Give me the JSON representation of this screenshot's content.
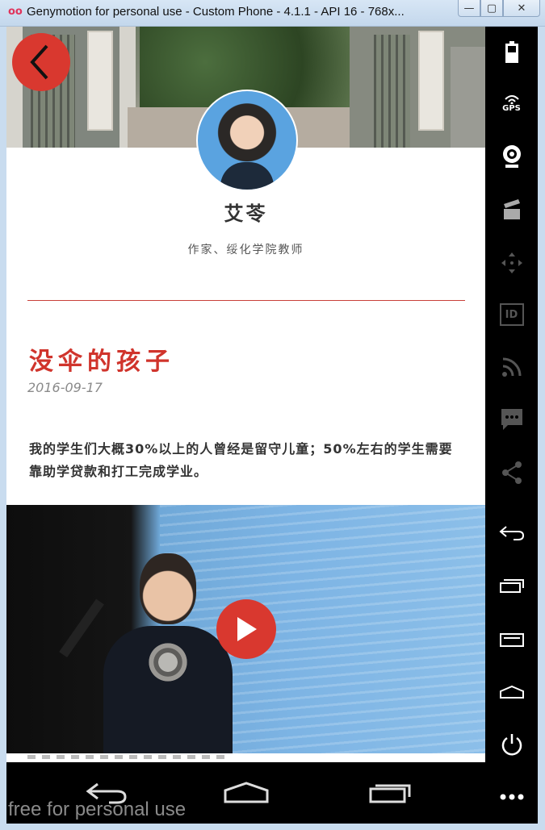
{
  "window": {
    "title": "Genymotion for personal use - Custom Phone - 4.1.1 - API 16 - 768x...",
    "app_icon_glyph": "oo",
    "minimize_glyph": "—",
    "maximize_glyph": "▢",
    "close_glyph": "✕"
  },
  "profile": {
    "name": "艾苓",
    "subtitle": "作家、绥化学院教师"
  },
  "article": {
    "title": "没伞的孩子",
    "date": "2016-09-17",
    "body": "我的学生们大概30%以上的人曾经是留守儿童；50%左右的学生需要靠助学贷款和打工完成学业。"
  },
  "side_panel": {
    "gps_label": "GPS",
    "id_label": "ID",
    "icons": [
      "battery-icon",
      "gps-icon",
      "webcam-icon",
      "clapper-icon",
      "dpad-icon",
      "id-icon",
      "rss-icon",
      "sms-icon",
      "share-icon",
      "back-icon",
      "recent-apps-icon",
      "menu-icon",
      "home-icon",
      "power-icon",
      "more-icon"
    ]
  },
  "watermark": "free for personal use",
  "colors": {
    "accent": "#d9382f",
    "title_red": "#d0342c",
    "divider": "#c9403a"
  }
}
